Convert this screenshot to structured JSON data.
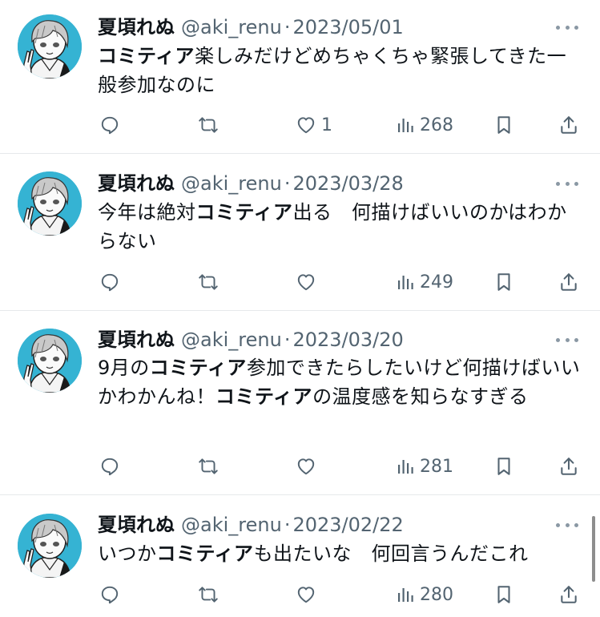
{
  "colors": {
    "avatar_bg": "#35b3d3",
    "text": "#0f1419",
    "muted": "#536471",
    "divider": "#e6e9eb"
  },
  "icons": [
    "reply-icon",
    "retweet-icon",
    "like-icon",
    "views-icon",
    "bookmark-icon",
    "share-icon",
    "more-icon"
  ],
  "tweets": [
    {
      "name": "夏頃れぬ",
      "handle": "@aki_renu",
      "dot": "·",
      "date": "2023/05/01",
      "segments": [
        {
          "t": "コミティア",
          "b": true
        },
        {
          "t": "楽しみだけどめちゃくちゃ緊張してきた一般参加なのに",
          "b": false
        }
      ],
      "likes": "1",
      "views": "268"
    },
    {
      "name": "夏頃れぬ",
      "handle": "@aki_renu",
      "dot": "·",
      "date": "2023/03/28",
      "segments": [
        {
          "t": "今年は絶対",
          "b": false
        },
        {
          "t": "コミティア",
          "b": true
        },
        {
          "t": "出る　何描けばいいのかはわからない",
          "b": false
        }
      ],
      "likes": "",
      "views": "249"
    },
    {
      "name": "夏頃れぬ",
      "handle": "@aki_renu",
      "dot": "·",
      "date": "2023/03/20",
      "segments": [
        {
          "t": "9月の",
          "b": false
        },
        {
          "t": "コミティア",
          "b": true
        },
        {
          "t": "参加できたらしたいけど何描けばいいかわかんね！",
          "b": false
        },
        {
          "t": "コミティア",
          "b": true
        },
        {
          "t": "の温度感を知らなすぎる",
          "b": false
        }
      ],
      "likes": "",
      "views": "281"
    },
    {
      "name": "夏頃れぬ",
      "handle": "@aki_renu",
      "dot": "·",
      "date": "2023/02/22",
      "segments": [
        {
          "t": "いつか",
          "b": false
        },
        {
          "t": "コミティア",
          "b": true
        },
        {
          "t": "も出たいな　何回言うんだこれ",
          "b": false
        }
      ],
      "likes": "",
      "views": "280"
    }
  ]
}
